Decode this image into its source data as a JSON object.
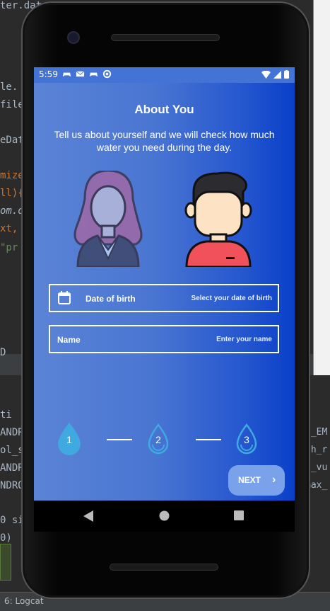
{
  "ide": {
    "code_lines_left": [
      "ter.date",
      "le.",
      "file",
      "eDat",
      "mize",
      "ll){",
      "om.d",
      "xt,",
      "\"pr",
      "D",
      "ti",
      "ANDR",
      "ol_s",
      "ANDRO",
      "NDRO",
      "0 si",
      "0)"
    ],
    "code_lines_right": [
      "D_EM",
      "th_r",
      "U_vu",
      "max_"
    ],
    "status_tab": "6: Logcat"
  },
  "app": {
    "status_bar": {
      "time": "5:59"
    },
    "title": "About You",
    "subtitle": "Tell us about yourself and we will check how much water you need during the day.",
    "fields": {
      "dob": {
        "label": "Date of birth",
        "hint": "Select your date of birth"
      },
      "name": {
        "label": "Name",
        "hint": "Enter your name"
      }
    },
    "steps": [
      "1",
      "2",
      "3"
    ],
    "next_button": "NEXT",
    "colors": {
      "accent": "#3fa9e0",
      "gradient_start": "#5b84d6",
      "gradient_end": "#0a3fc9"
    }
  }
}
